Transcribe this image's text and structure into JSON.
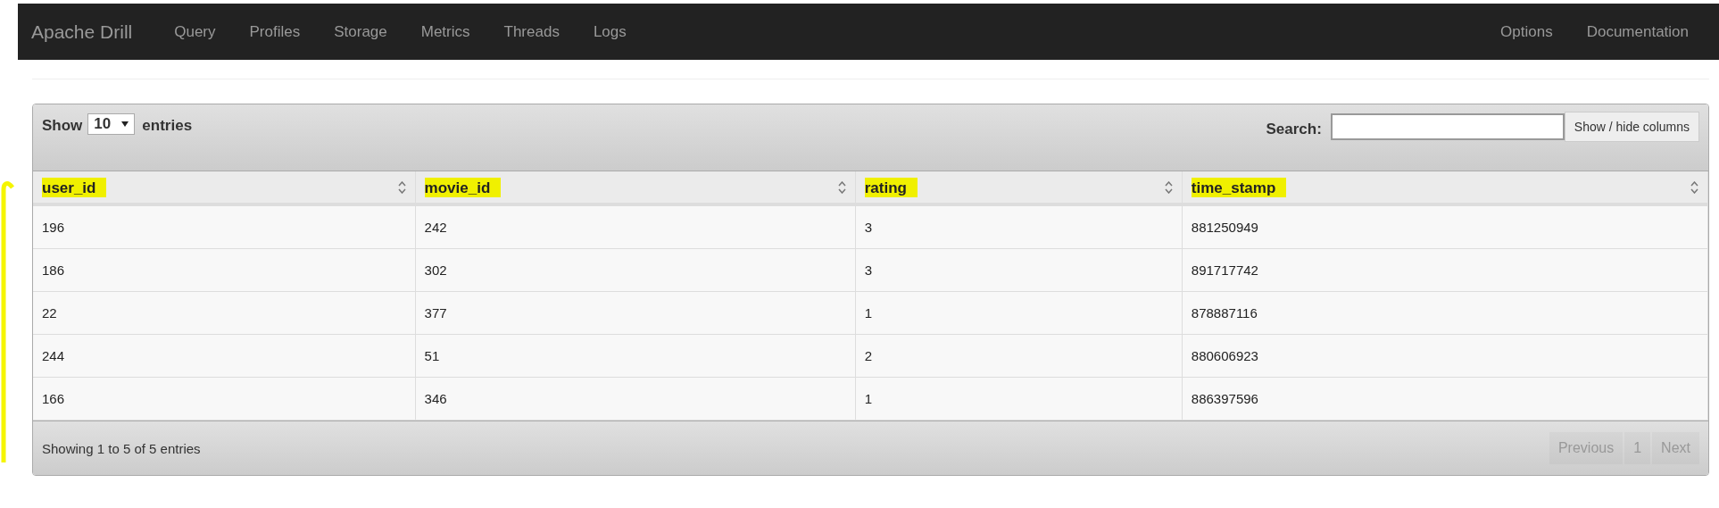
{
  "navbar": {
    "brand": "Apache Drill",
    "links": [
      "Query",
      "Profiles",
      "Storage",
      "Metrics",
      "Threads",
      "Logs"
    ],
    "right_links": [
      "Options",
      "Documentation"
    ]
  },
  "table_controls": {
    "show_label": "Show",
    "page_size": "10",
    "entries_label": "entries",
    "search_label": "Search:",
    "column_button": "Show / hide columns"
  },
  "table": {
    "columns": [
      "user_id",
      "movie_id",
      "rating",
      "time_stamp"
    ],
    "rows": [
      [
        "196",
        "242",
        "3",
        "881250949"
      ],
      [
        "186",
        "302",
        "3",
        "891717742"
      ],
      [
        "22",
        "377",
        "1",
        "878887116"
      ],
      [
        "244",
        "51",
        "2",
        "880606923"
      ],
      [
        "166",
        "346",
        "1",
        "886397596"
      ]
    ]
  },
  "footer": {
    "info": "Showing 1 to 5 of 5 entries",
    "pagination": [
      {
        "label": "Previous",
        "disabled": true
      },
      {
        "label": "1",
        "disabled": true
      },
      {
        "label": "Next",
        "disabled": true
      }
    ]
  }
}
